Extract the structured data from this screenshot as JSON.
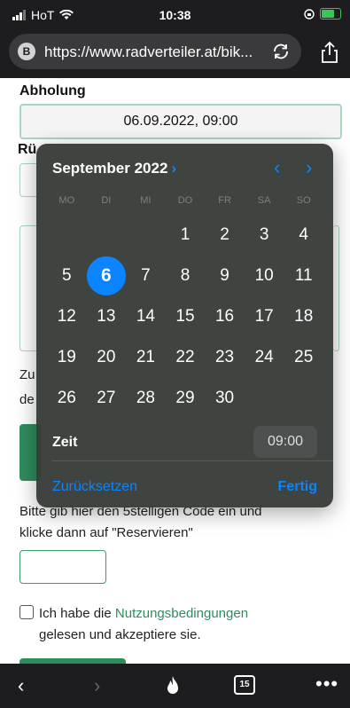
{
  "status_bar": {
    "carrier": "HoT",
    "time": "10:38"
  },
  "browser": {
    "site_badge": "B",
    "url": "https://www.radverteiler.at/bik...",
    "tab_count": "15"
  },
  "form": {
    "pickup_label": "Abholung",
    "pickup_value": "06.09.2022, 09:00",
    "return_label_fragment": "Rü",
    "frag_zu": "Zu",
    "frag_de": "de",
    "code_instruction_1": "Bitte gib hier den 5stelligen Code ein und",
    "code_instruction_2": "klicke dann auf \"Reservieren\"",
    "terms_prefix": "Ich habe die ",
    "terms_link": "Nutzungsbedingungen",
    "terms_suffix": "gelesen und akzeptiere sie."
  },
  "picker": {
    "month_label": "September 2022",
    "weekdays": [
      "MO",
      "DI",
      "MI",
      "DO",
      "FR",
      "SA",
      "SO"
    ],
    "selected_day": "6",
    "time_label": "Zeit",
    "time_value": "09:00",
    "reset_label": "Zurücksetzen",
    "done_label": "Fertig",
    "days": [
      "",
      "",
      "",
      "1",
      "2",
      "3",
      "4",
      "5",
      "6",
      "7",
      "8",
      "9",
      "10",
      "11",
      "12",
      "13",
      "14",
      "15",
      "16",
      "17",
      "18",
      "19",
      "20",
      "21",
      "22",
      "23",
      "24",
      "25",
      "26",
      "27",
      "28",
      "29",
      "30",
      "",
      ""
    ]
  },
  "colors": {
    "accent": "#0a84ff",
    "brand_green": "#2f8c5d",
    "picker_bg": "#383c39"
  }
}
